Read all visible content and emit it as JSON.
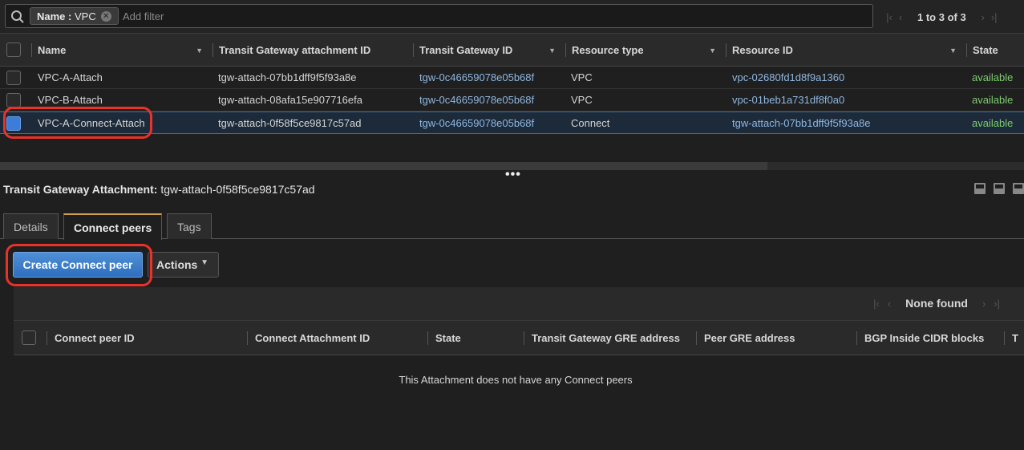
{
  "filter": {
    "token_key": "Name",
    "token_value": "VPC",
    "placeholder": "Add filter",
    "pagination": "1 to 3 of 3"
  },
  "table": {
    "columns": [
      "Name",
      "Transit Gateway attachment ID",
      "Transit Gateway ID",
      "Resource type",
      "Resource ID",
      "State"
    ],
    "rows": [
      {
        "name": "VPC-A-Attach",
        "attachment_id": "tgw-attach-07bb1dff9f5f93a8e",
        "tgw_id": "tgw-0c46659078e05b68f",
        "resource_type": "VPC",
        "resource_id": "vpc-02680fd1d8f9a1360",
        "state": "available",
        "selected": false
      },
      {
        "name": "VPC-B-Attach",
        "attachment_id": "tgw-attach-08afa15e907716efa",
        "tgw_id": "tgw-0c46659078e05b68f",
        "resource_type": "VPC",
        "resource_id": "vpc-01beb1a731df8f0a0",
        "state": "available",
        "selected": false
      },
      {
        "name": "VPC-A-Connect-Attach",
        "attachment_id": "tgw-attach-0f58f5ce9817c57ad",
        "tgw_id": "tgw-0c46659078e05b68f",
        "resource_type": "Connect",
        "resource_id": "tgw-attach-07bb1dff9f5f93a8e",
        "state": "available",
        "selected": true
      }
    ]
  },
  "detail": {
    "label": "Transit Gateway Attachment:",
    "value": "tgw-attach-0f58f5ce9817c57ad",
    "tabs": [
      "Details",
      "Connect peers",
      "Tags"
    ],
    "active_tab": "Connect peers",
    "create_button": "Create Connect peer",
    "actions_button": "Actions",
    "sub_pagination": "None found",
    "sub_columns": [
      "Connect peer ID",
      "Connect Attachment ID",
      "State",
      "Transit Gateway GRE address",
      "Peer GRE address",
      "BGP Inside CIDR blocks",
      "T"
    ],
    "empty_message": "This Attachment does not have any Connect peers"
  },
  "colors": {
    "link": "#8fb7e0",
    "available": "#7ecb6f",
    "primary": "#3b7dd8",
    "highlight": "#e8322a"
  }
}
